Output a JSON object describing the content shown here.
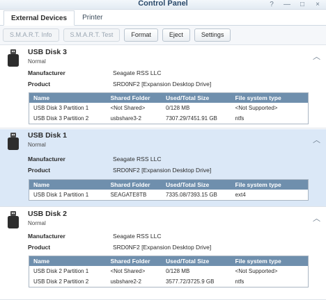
{
  "window": {
    "title": "Control Panel",
    "help_icon": "?",
    "minimize_icon": "—",
    "maximize_icon": "□",
    "close_icon": "×"
  },
  "tabs": [
    {
      "label": "External Devices",
      "active": true
    },
    {
      "label": "Printer",
      "active": false
    }
  ],
  "toolbar": {
    "smart_info": "S.M.A.R.T. Info",
    "smart_test": "S.M.A.R.T. Test",
    "format": "Format",
    "eject": "Eject",
    "settings": "Settings"
  },
  "labels": {
    "manufacturer": "Manufacturer",
    "product": "Product"
  },
  "columns": [
    "Name",
    "Shared Folder",
    "Used/Total Size",
    "File system type"
  ],
  "colors": {
    "selected_row": "#dbe8f7",
    "table_header": "#6f8fad",
    "title_text": "#2b4a6b"
  },
  "disks": [
    {
      "name": "USB Disk 3",
      "status": "Normal",
      "manufacturer": "Seagate RSS LLC",
      "product": "SRD0NF2 [Expansion Desktop Drive]",
      "selected": false,
      "partitions": [
        {
          "name": "USB Disk 3 Partition 1",
          "shared": "<Not Shared>",
          "size": "0/128 MB",
          "fs": "<Not Supported>"
        },
        {
          "name": "USB Disk 3 Partition 2",
          "shared": "usbshare3-2",
          "size": "7307.29/7451.91 GB",
          "fs": "ntfs"
        }
      ]
    },
    {
      "name": "USB Disk 1",
      "status": "Normal",
      "manufacturer": "Seagate RSS LLC",
      "product": "SRD0NF2 [Expansion Desktop Drive]",
      "selected": true,
      "partitions": [
        {
          "name": "USB Disk 1 Partition 1",
          "shared": "SEAGATE8TB",
          "size": "7335.08/7393.15 GB",
          "fs": "ext4"
        }
      ]
    },
    {
      "name": "USB Disk 2",
      "status": "Normal",
      "manufacturer": "Seagate RSS LLC",
      "product": "SRD0NF2 [Expansion Desktop Drive]",
      "selected": false,
      "partitions": [
        {
          "name": "USB Disk 2 Partition 1",
          "shared": "<Not Shared>",
          "size": "0/128 MB",
          "fs": "<Not Supported>"
        },
        {
          "name": "USB Disk 2 Partition 2",
          "shared": "usbshare2-2",
          "size": "3577.72/3725.9 GB",
          "fs": "ntfs"
        }
      ]
    }
  ]
}
